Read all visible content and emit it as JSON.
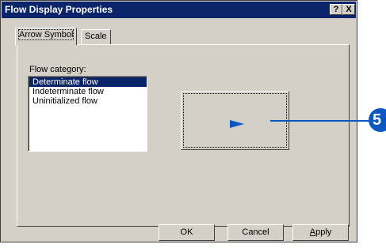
{
  "window": {
    "title": "Flow Display Properties",
    "help_button": "?",
    "close_button": "X"
  },
  "tabs": [
    {
      "label": "Arrow Symbol",
      "active": true
    },
    {
      "label": "Scale",
      "active": false
    }
  ],
  "flow_category": {
    "label": "Flow category:",
    "items": [
      "Determinate flow",
      "Indeterminate flow",
      "Uninitialized flow"
    ],
    "selected": "Determinate flow"
  },
  "preview": {
    "arrow_icon": "right-triangle-arrow",
    "arrow_color": "#0a57c4"
  },
  "callout": {
    "number": "5",
    "color": "#0a57c4"
  },
  "buttons": {
    "ok": "OK",
    "cancel": "Cancel",
    "apply_underlined": "A",
    "apply_rest": "pply"
  }
}
